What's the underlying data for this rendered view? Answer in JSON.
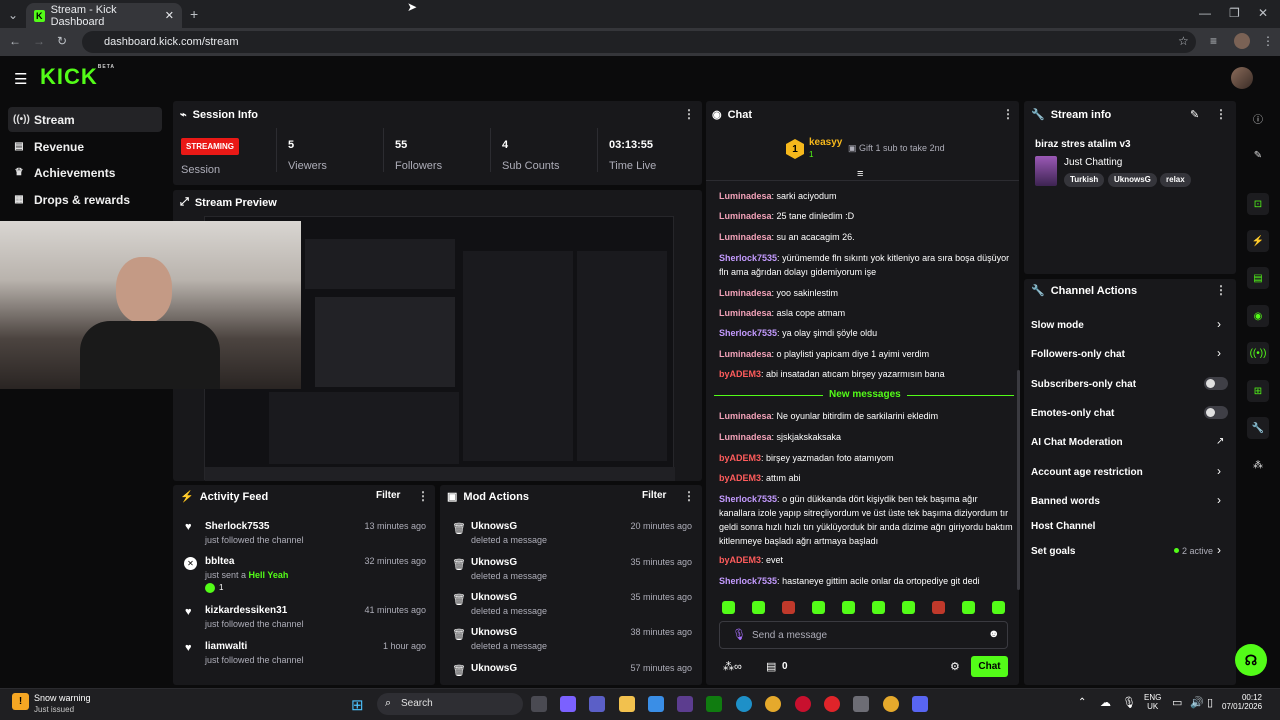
{
  "browser": {
    "tab_title": "Stream - Kick Dashboard",
    "url": "dashboard.kick.com/stream"
  },
  "header": {
    "logo": "KICK",
    "logo_badge": "BETA"
  },
  "nav": [
    {
      "label": "Stream",
      "icon": "broadcast-icon"
    },
    {
      "label": "Revenue",
      "icon": "revenue-icon"
    },
    {
      "label": "Achievements",
      "icon": "trophy-icon"
    },
    {
      "label": "Drops & rewards",
      "icon": "gift-icon"
    }
  ],
  "session": {
    "title": "Session Info",
    "status": "STREAMING",
    "status_label": "Session",
    "viewers": "5",
    "viewers_label": "Viewers",
    "followers": "55",
    "followers_label": "Followers",
    "subs": "4",
    "subs_label": "Sub Counts",
    "time": "03:13:55",
    "time_label": "Time Live"
  },
  "preview": {
    "title": "Stream Preview"
  },
  "activity": {
    "title": "Activity Feed",
    "filter": "Filter",
    "items": [
      {
        "name": "Sherlock7535",
        "sub": "just followed the channel",
        "time": "13 minutes ago"
      },
      {
        "name": "bbltea",
        "sub": "just sent a",
        "sub_em": "Hell Yeah",
        "count": "1",
        "time": "32 minutes ago"
      },
      {
        "name": "kizkardessiken31",
        "sub": "just followed the channel",
        "time": "41 minutes ago"
      },
      {
        "name": "liamwalti",
        "sub": "just followed the channel",
        "time": "1 hour ago"
      }
    ]
  },
  "mod": {
    "title": "Mod Actions",
    "filter": "Filter",
    "items": [
      {
        "name": "UknowsG",
        "sub": "deleted a message",
        "time": "20 minutes ago"
      },
      {
        "name": "UknowsG",
        "sub": "deleted a message",
        "time": "35 minutes ago"
      },
      {
        "name": "UknowsG",
        "sub": "deleted a message",
        "time": "35 minutes ago"
      },
      {
        "name": "UknowsG",
        "sub": "deleted a message",
        "time": "38 minutes ago"
      },
      {
        "name": "UknowsG",
        "sub": "deleted a message",
        "time": "57 minutes ago"
      }
    ]
  },
  "chat": {
    "title": "Chat",
    "top_gifter": "keasyy",
    "top_gifter_count": "1",
    "gift_hint": "Gift 1 sub to take 2nd",
    "new_messages": "New messages",
    "input_placeholder": "Send a message",
    "points": "0",
    "send": "Chat",
    "messages": [
      {
        "user": "Luminadesa",
        "text": "sarki aciyodum",
        "c": "u-green"
      },
      {
        "user": "Luminadesa",
        "text": "25 tane dinledim :D",
        "c": "u-green"
      },
      {
        "user": "Luminadesa",
        "text": "su an acacagim 26.",
        "c": "u-green"
      },
      {
        "user": "Sherlock7535",
        "text": "yürümemde fln sıkıntı yok kitleniyo ara sıra boşa düşüyor fln ama ağrıdan dolayı gidemiyorum işe",
        "c": "u-sher"
      },
      {
        "user": "Luminadesa",
        "text": "yoo sakinlestim",
        "c": "u-green"
      },
      {
        "user": "Luminadesa",
        "text": "asla cope atmam",
        "c": "u-green"
      },
      {
        "user": "Sherlock7535",
        "text": "ya olay şimdi şöyle oldu",
        "c": "u-sher"
      },
      {
        "user": "Luminadesa",
        "text": "o playlisti yapicam diye 1 ayimi verdim",
        "c": "u-green"
      },
      {
        "user": "byADEM3",
        "text": "abi insatadan atıcam birşey yazarmısın bana",
        "c": "u-adem"
      },
      {
        "user": "Luminadesa",
        "text": "Ne oyunlar bitirdim de sarkilarini ekledim",
        "c": "u-green"
      },
      {
        "user": "Luminadesa",
        "text": "sjskjakskaksaka",
        "c": "u-green"
      },
      {
        "user": "byADEM3",
        "text": "birşey yazmadan foto atamıyom",
        "c": "u-adem"
      },
      {
        "user": "byADEM3",
        "text": "attım abi",
        "c": "u-adem"
      },
      {
        "user": "Sherlock7535",
        "text": "o gün dükkanda dört kişiydik ben tek başıma ağır kanallara izole yapıp sitreçliyordum ve üst üste tek başıma diziyordum tır geldi sonra hızlı hızlı tırı yüklüyorduk bir anda dizime ağrı giriyordu baktım kitlenmeye başladı ağrı artmaya başladı",
        "c": "u-sher"
      },
      {
        "user": "byADEM3",
        "text": "evet",
        "c": "u-adem"
      },
      {
        "user": "Sherlock7535",
        "text": "hastaneye gittim acile onlar da ortopediye git dedi",
        "c": "u-sher"
      }
    ]
  },
  "stream_info": {
    "title": "Stream info",
    "stream_title": "biraz stres atalim v3",
    "category": "Just Chatting",
    "tags": [
      "Turkish",
      "UknowsG",
      "relax"
    ]
  },
  "channel_actions": {
    "title": "Channel Actions",
    "slow": "Slow mode",
    "followers": "Followers-only chat",
    "subscribers": "Subscribers-only chat",
    "emotes": "Emotes-only chat",
    "ai": "AI Chat Moderation",
    "age": "Account age restriction",
    "banned": "Banned words",
    "host": "Host Channel",
    "goals": "Set goals",
    "goals_active": "2 active"
  },
  "taskbar": {
    "weather_title": "Snow warning",
    "weather_sub": "Just issued",
    "search": "Search",
    "lang": "ENG",
    "lang2": "UK",
    "time": "00:12",
    "date": "07/01/2026"
  },
  "colors": {
    "accent": "#53fc18",
    "live": "#e91916",
    "panel": "#18181b",
    "bg": "#0b0b0c"
  }
}
